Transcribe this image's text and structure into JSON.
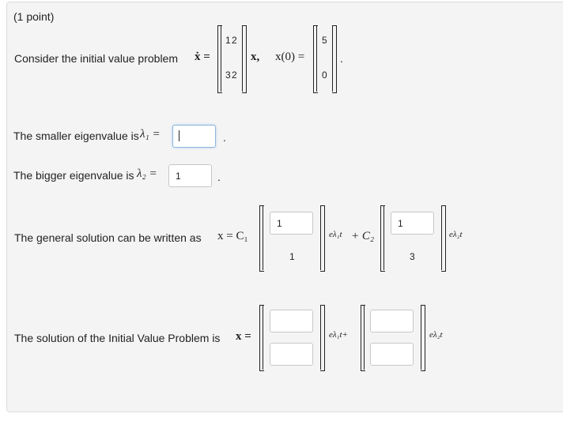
{
  "header": {
    "points": "(1 point)"
  },
  "q1": {
    "prompt": "Consider the initial value problem",
    "xdot": "ẋ =",
    "A": [
      "1",
      "2",
      "3",
      "2"
    ],
    "x_comma": "x,",
    "x0": "x(0) =",
    "x0_vec": [
      "5",
      "0"
    ],
    "period": "."
  },
  "eig": {
    "smaller_label": "The smaller eigenvalue is",
    "lambda1": "λ₁ =",
    "smaller_value": "",
    "bigger_label": "The bigger eigenvalue is",
    "lambda2": "λ₂ =",
    "bigger_value": "1",
    "period": "."
  },
  "general": {
    "label": "The general solution can be written as",
    "x_eq": "x = C₁",
    "v1_top": "1",
    "v1_bottom": "1",
    "exp1": "eλ₁t",
    "plus_c2": "+ C₂",
    "v2_top": "1",
    "v2_bottom": "3",
    "exp2": "eλ₂t"
  },
  "ivp": {
    "label": "The solution of the Initial Value Problem is",
    "x_eq": "x =",
    "v1_top": "",
    "v1_bottom": "",
    "exp1": "eλ₁t+",
    "v2_top": "",
    "v2_bottom": "",
    "exp2": "eλ₂t"
  }
}
